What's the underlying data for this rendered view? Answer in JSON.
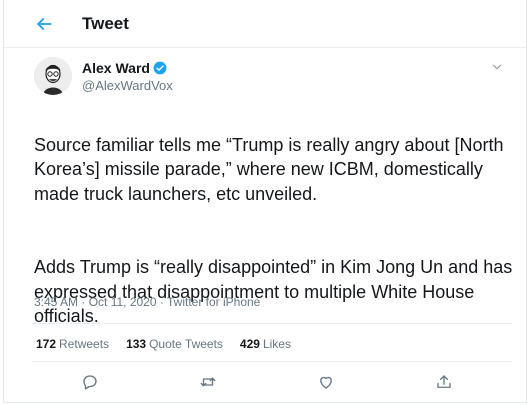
{
  "header": {
    "title": "Tweet",
    "back_icon": "back-arrow-icon"
  },
  "author": {
    "name": "Alex Ward",
    "handle": "@AlexWardVox",
    "verified": true
  },
  "tweet": {
    "paragraphs": [
      "Source familiar tells me “Trump is really angry about [North Korea’s] missile parade,” where new ICBM, domestically made truck launchers, etc unveiled.",
      "Adds Trump is “really disappointed” in Kim Jong Un and has expressed that disappointment to multiple White House officials."
    ]
  },
  "meta": {
    "time": "3:45 AM",
    "sep": " · ",
    "date": "Oct 11, 2020",
    "source": "Twitter for iPhone"
  },
  "stats": {
    "retweets_count": "172",
    "retweets_label": "Retweets",
    "quotes_count": "133",
    "quotes_label": "Quote Tweets",
    "likes_count": "429",
    "likes_label": "Likes"
  },
  "colors": {
    "accent": "#1da1f2",
    "text": "#14171a",
    "muted": "#657786",
    "border": "#e6ecf0"
  },
  "actions": [
    "reply-icon",
    "retweet-icon",
    "like-icon",
    "share-icon"
  ]
}
